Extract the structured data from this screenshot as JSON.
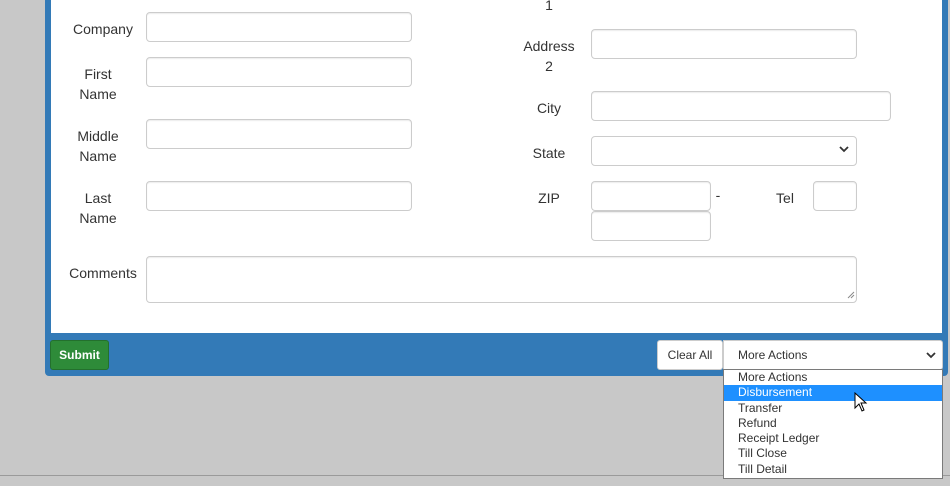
{
  "form": {
    "address1_partial": "1",
    "labels": {
      "company": "Company",
      "first_name_l1": "First",
      "first_name_l2": "Name",
      "middle_name_l1": "Middle",
      "middle_name_l2": "Name",
      "last_name_l1": "Last",
      "last_name_l2": "Name",
      "comments": "Comments",
      "address2_l1": "Address",
      "address2_l2": "2",
      "city": "City",
      "state": "State",
      "zip": "ZIP",
      "zip_separator": "-",
      "tel": "Tel"
    },
    "values": {
      "company": "",
      "first_name": "",
      "middle_name": "",
      "last_name": "",
      "comments": "",
      "address2": "",
      "city": "",
      "state": "",
      "zip": "",
      "zip_ext": "",
      "tel": ""
    }
  },
  "footer": {
    "submit_label": "Submit",
    "clear_label": "Clear All",
    "more_actions_selected": "More Actions",
    "more_actions_options": [
      {
        "label": "More Actions",
        "highlighted": false
      },
      {
        "label": "Disbursement",
        "highlighted": true
      },
      {
        "label": "Transfer",
        "highlighted": false
      },
      {
        "label": "Refund",
        "highlighted": false
      },
      {
        "label": "Receipt Ledger",
        "highlighted": false
      },
      {
        "label": "Till Close",
        "highlighted": false
      },
      {
        "label": "Till Detail",
        "highlighted": false
      }
    ]
  },
  "colors": {
    "panel": "#337ab7",
    "submit": "#2e8b39",
    "highlight": "#1e90ff",
    "page_background": "#c8c8c8"
  }
}
